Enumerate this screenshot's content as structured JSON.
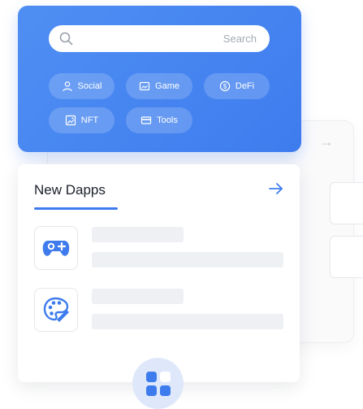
{
  "search": {
    "placeholder": "Search"
  },
  "categories": [
    {
      "label": "Social",
      "icon": "user-icon"
    },
    {
      "label": "Game",
      "icon": "image-icon"
    },
    {
      "label": "DeFi",
      "icon": "dollar-icon"
    },
    {
      "label": "NFT",
      "icon": "picture-icon"
    },
    {
      "label": "Tools",
      "icon": "card-icon"
    }
  ],
  "dapps": {
    "title": "New Dapps"
  },
  "colors": {
    "accent": "#3e7cee",
    "panel": "#4f8ff3",
    "skeleton": "#eef0f3"
  }
}
